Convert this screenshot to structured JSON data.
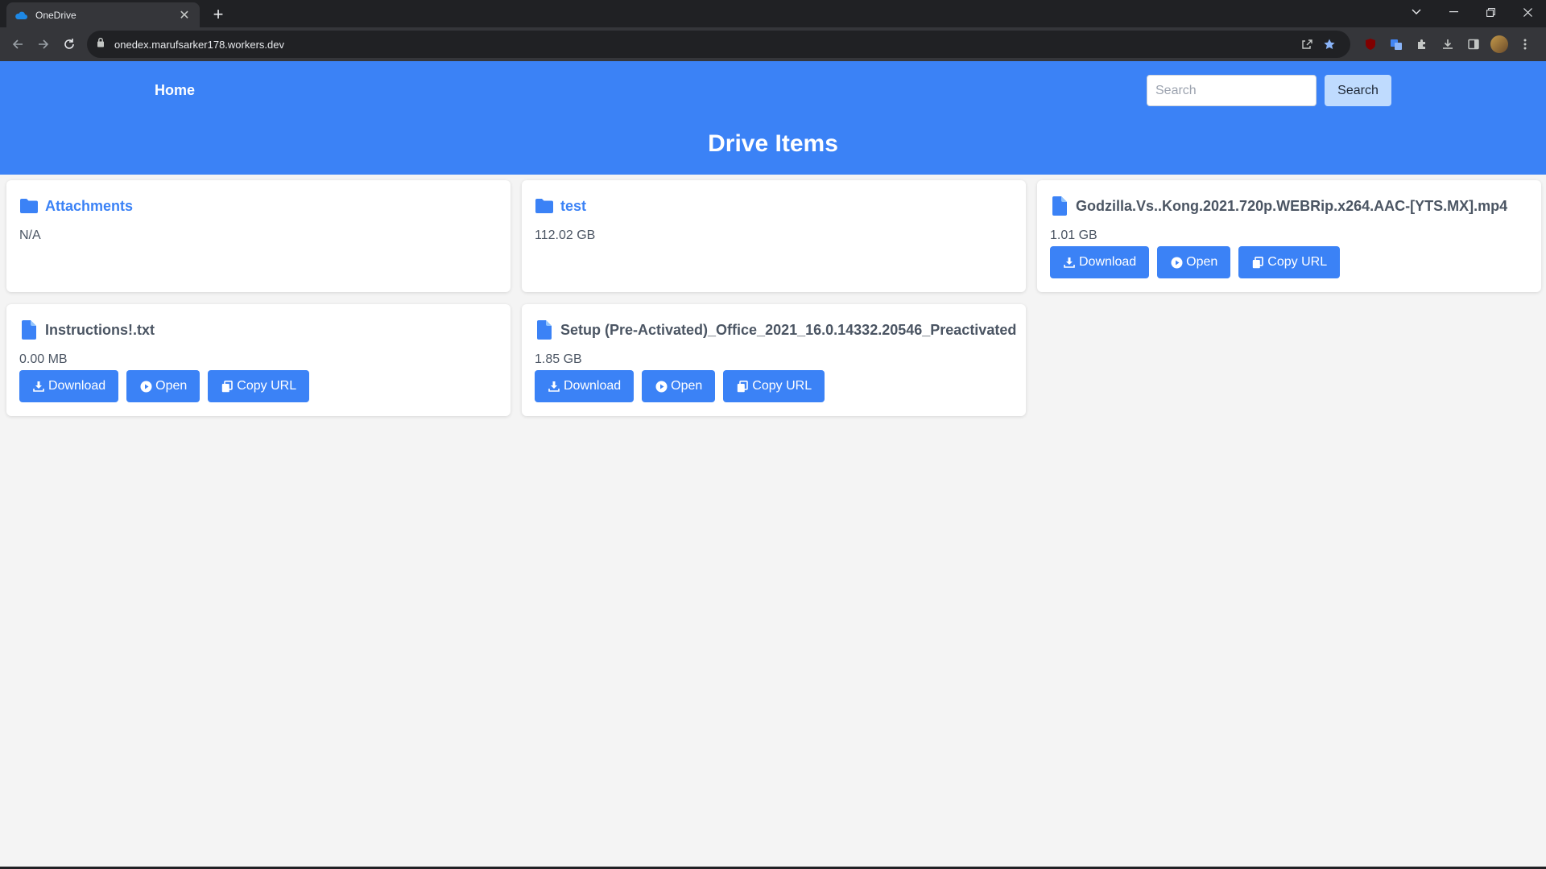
{
  "browser": {
    "tab_title": "OneDrive",
    "url": "onedex.marufsarker178.workers.dev"
  },
  "header": {
    "home_label": "Home",
    "search_placeholder": "Search",
    "search_button": "Search",
    "title": "Drive Items"
  },
  "items": [
    {
      "kind": "folder",
      "name": "Attachments",
      "size": "N/A"
    },
    {
      "kind": "folder",
      "name": "test",
      "size": "112.02 GB"
    },
    {
      "kind": "file",
      "name": "Godzilla.Vs..Kong.2021.720p.WEBRip.x264.AAC-[YTS.MX].mp4",
      "size": "1.01 GB"
    },
    {
      "kind": "file",
      "name": "Instructions!.txt",
      "size": "0.00 MB"
    },
    {
      "kind": "file",
      "name": "Setup (Pre-Activated)_Office_2021_16.0.14332.20546_Preactivated",
      "size": "1.85 GB"
    }
  ],
  "actions": {
    "download": "Download",
    "open": "Open",
    "copy_url": "Copy URL"
  },
  "colors": {
    "accent": "#3b82f6",
    "search_button_bg": "#bfdbfe",
    "page_bg": "#f4f4f4"
  }
}
